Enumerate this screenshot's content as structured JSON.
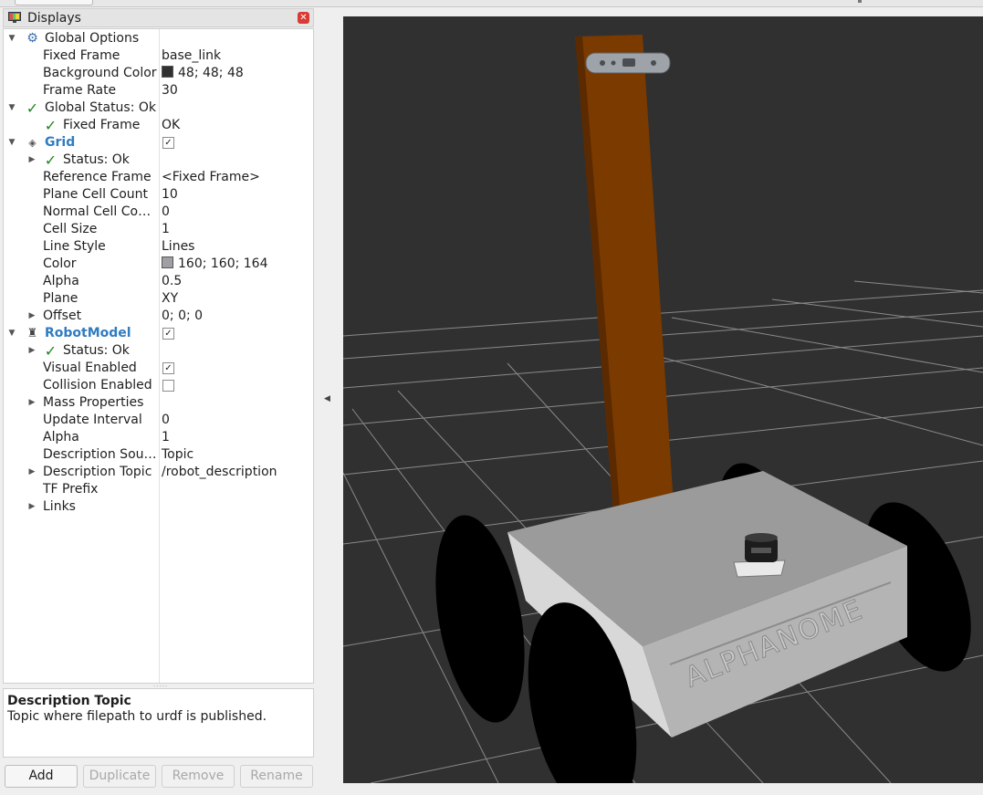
{
  "panel": {
    "title": "Displays"
  },
  "tree": {
    "rows": [
      {
        "indent": 0,
        "arrow": "down",
        "icon": "gear-icon",
        "name": "Global Options",
        "value": ""
      },
      {
        "indent": 1,
        "arrow": "",
        "icon": "",
        "name": "Fixed Frame",
        "value": "base_link"
      },
      {
        "indent": 1,
        "arrow": "",
        "icon": "",
        "name": "Background Color",
        "value": "48; 48; 48",
        "swatch": "#303030"
      },
      {
        "indent": 1,
        "arrow": "",
        "icon": "",
        "name": "Frame Rate",
        "value": "30"
      },
      {
        "indent": 0,
        "arrow": "down",
        "icon": "check-icon",
        "name": "Global Status: Ok",
        "value": ""
      },
      {
        "indent": 1,
        "arrow": "",
        "icon": "check-icon",
        "name": "Fixed Frame",
        "value": "OK"
      },
      {
        "indent": 0,
        "arrow": "down",
        "icon": "grid-icon",
        "name": "Grid",
        "value": "",
        "bold": true,
        "checkbox": true,
        "checked": true
      },
      {
        "indent": 1,
        "arrow": "right",
        "icon": "check-icon",
        "name": "Status: Ok",
        "value": ""
      },
      {
        "indent": 1,
        "arrow": "",
        "icon": "",
        "name": "Reference Frame",
        "value": "<Fixed Frame>"
      },
      {
        "indent": 1,
        "arrow": "",
        "icon": "",
        "name": "Plane Cell Count",
        "value": "10"
      },
      {
        "indent": 1,
        "arrow": "",
        "icon": "",
        "name": "Normal Cell Co…",
        "value": "0"
      },
      {
        "indent": 1,
        "arrow": "",
        "icon": "",
        "name": "Cell Size",
        "value": "1"
      },
      {
        "indent": 1,
        "arrow": "",
        "icon": "",
        "name": "Line Style",
        "value": "Lines"
      },
      {
        "indent": 1,
        "arrow": "",
        "icon": "",
        "name": "Color",
        "value": "160; 160; 164",
        "swatch": "#a0a0a4"
      },
      {
        "indent": 1,
        "arrow": "",
        "icon": "",
        "name": "Alpha",
        "value": "0.5"
      },
      {
        "indent": 1,
        "arrow": "",
        "icon": "",
        "name": "Plane",
        "value": "XY"
      },
      {
        "indent": 1,
        "arrow": "right",
        "icon": "",
        "name": "Offset",
        "value": "0; 0; 0"
      },
      {
        "indent": 0,
        "arrow": "down",
        "icon": "robot-icon",
        "name": "RobotModel",
        "value": "",
        "bold": true,
        "checkbox": true,
        "checked": true
      },
      {
        "indent": 1,
        "arrow": "right",
        "icon": "check-icon",
        "name": "Status: Ok",
        "value": ""
      },
      {
        "indent": 1,
        "arrow": "",
        "icon": "",
        "name": "Visual Enabled",
        "value": "",
        "checkbox": true,
        "checked": true
      },
      {
        "indent": 1,
        "arrow": "",
        "icon": "",
        "name": "Collision Enabled",
        "value": "",
        "checkbox": true,
        "checked": false
      },
      {
        "indent": 1,
        "arrow": "right",
        "icon": "",
        "name": "Mass Properties",
        "value": ""
      },
      {
        "indent": 1,
        "arrow": "",
        "icon": "",
        "name": "Update Interval",
        "value": "0"
      },
      {
        "indent": 1,
        "arrow": "",
        "icon": "",
        "name": "Alpha",
        "value": "1"
      },
      {
        "indent": 1,
        "arrow": "",
        "icon": "",
        "name": "Description Sou…",
        "value": "Topic"
      },
      {
        "indent": 1,
        "arrow": "right",
        "icon": "",
        "name": "Description Topic",
        "value": "/robot_description"
      },
      {
        "indent": 1,
        "arrow": "",
        "icon": "",
        "name": "TF Prefix",
        "value": ""
      },
      {
        "indent": 1,
        "arrow": "right",
        "icon": "",
        "name": "Links",
        "value": ""
      }
    ]
  },
  "description": {
    "title": "Description Topic",
    "text": "Topic where filepath to urdf is published."
  },
  "buttons": {
    "add": "Add",
    "duplicate": "Duplicate",
    "remove": "Remove",
    "rename": "Rename"
  },
  "viewport": {
    "background": "#303030",
    "grid_color": "#8a8a8a",
    "mast_color": "#7a3a00",
    "base_color": "#bdbdbd",
    "wheel_color": "#000000",
    "engraving": "ALPHANOME"
  }
}
